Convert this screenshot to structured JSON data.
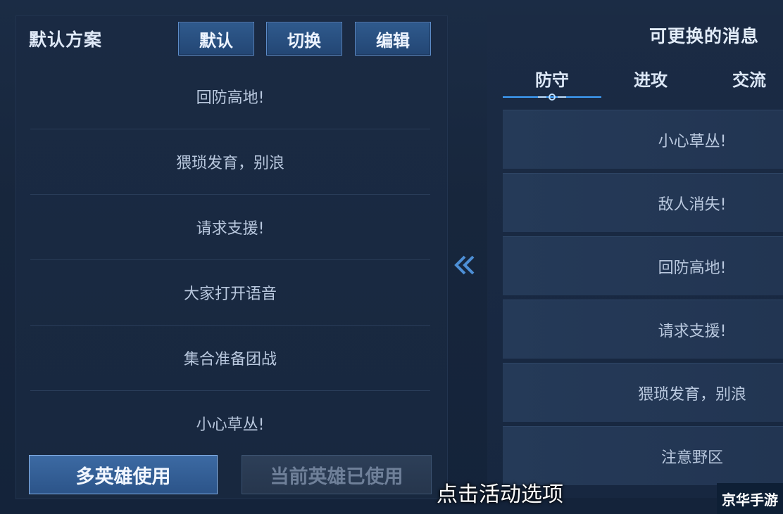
{
  "left_panel": {
    "title": "默认方案",
    "buttons": {
      "default": "默认",
      "switch": "切换",
      "edit": "编辑"
    },
    "messages": [
      "回防高地!",
      "猥琐发育，别浪",
      "请求支援!",
      "大家打开语音",
      "集合准备团战",
      "小心草丛!"
    ],
    "bottom": {
      "multi_hero": "多英雄使用",
      "current_hero": "当前英雄已使用"
    }
  },
  "right_panel": {
    "title": "可更换的消息",
    "tabs": [
      "防守",
      "进攻",
      "交流"
    ],
    "active_tab": "防守",
    "options": [
      "小心草丛!",
      "敌人消失!",
      "回防高地!",
      "请求支援!",
      "猥琐发育，别浪",
      "注意野区"
    ]
  },
  "caption": "点击活动选项",
  "watermark": "京华手游",
  "colors": {
    "accent": "#2f5a8d",
    "active_tab_glow": "#3fa2ff",
    "background": "#1b2c45"
  }
}
